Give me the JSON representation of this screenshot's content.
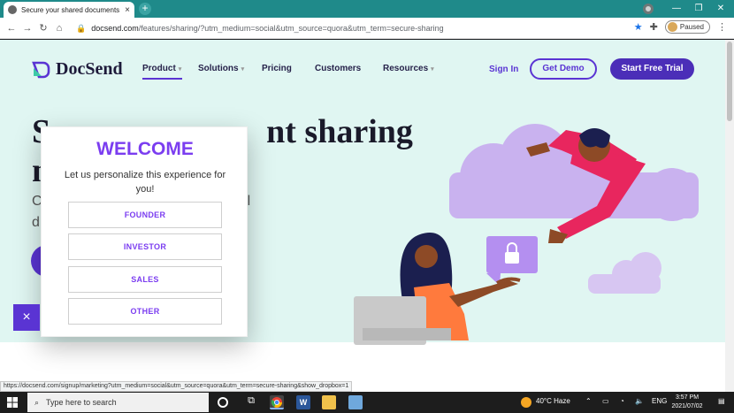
{
  "browser": {
    "tab_title": "Secure your shared documents",
    "tab_close": "×",
    "new_tab": "+",
    "url_host": "docsend.com",
    "url_path": "/features/sharing/?utm_medium=social&utm_source=quora&utm_term=secure-sharing",
    "profile_status": "Paused",
    "status_url": "https://docsend.com/signup/marketing?utm_medium=social&utm_source=quora&utm_term=secure-sharing&show_dropbox=1"
  },
  "nav": {
    "brand": "DocSend",
    "items": [
      {
        "label": "Product",
        "has_caret": true
      },
      {
        "label": "Solutions",
        "has_caret": true
      },
      {
        "label": "Pricing",
        "has_caret": false
      },
      {
        "label": "Customers",
        "has_caret": false
      },
      {
        "label": "Resources",
        "has_caret": true
      }
    ],
    "sign_in": "Sign In",
    "get_demo": "Get Demo",
    "start_trial": "Start Free Trial"
  },
  "hero": {
    "headline_left": "S",
    "headline_mid": "nt sharing",
    "line2_left": "m",
    "sub1_left": "C",
    "sub2_left": "d",
    "sub1_right": "l",
    "sub2_right": "."
  },
  "modal": {
    "title": "WELCOME",
    "subtitle": "Let us personalize this experience for you!",
    "options": [
      "FOUNDER",
      "INVESTOR",
      "SALES",
      "OTHER"
    ],
    "close": "×"
  },
  "taskbar": {
    "search_placeholder": "Type here to search",
    "weather": "40°C  Haze",
    "lang": "ENG",
    "time": "3:57 PM",
    "date": "2021/07/02"
  },
  "colors": {
    "accent": "#5a34d3",
    "modal_accent": "#7b3df0",
    "hero_bg": "#e0f6f2",
    "tab_bar": "#1f8a8a"
  }
}
